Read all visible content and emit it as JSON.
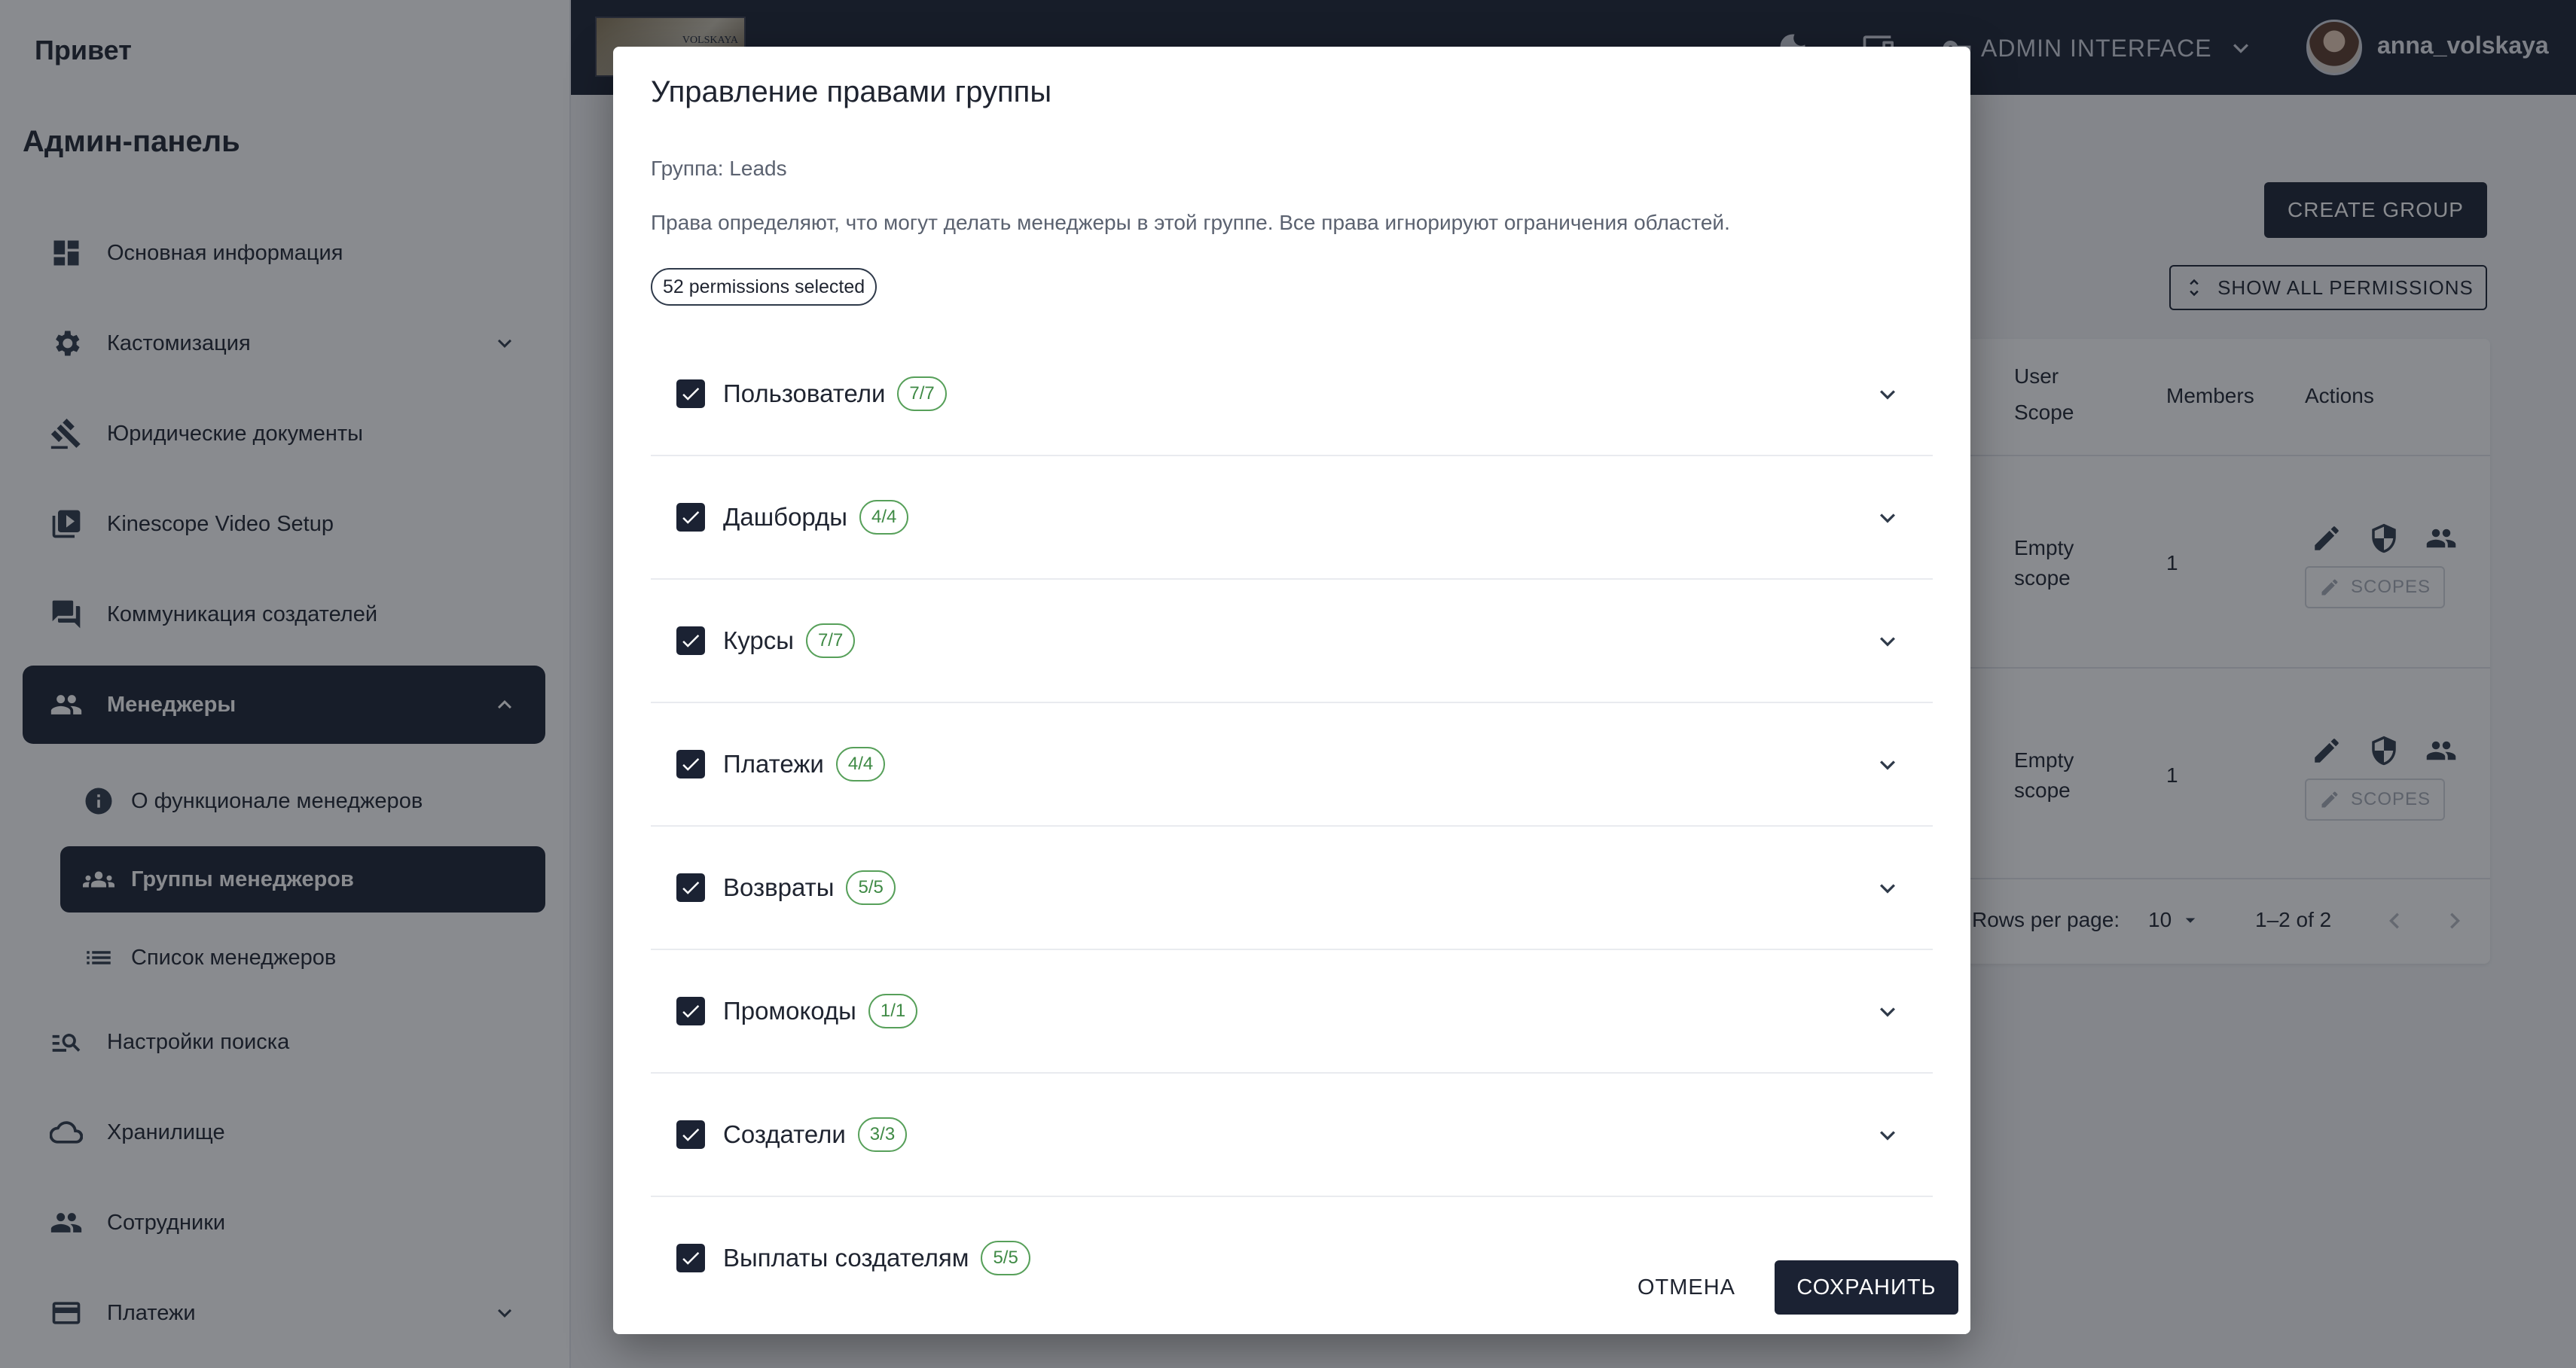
{
  "sidebar": {
    "greeting": "Привет",
    "panel_title": "Админ-панель",
    "items": [
      {
        "label": "Основная информация"
      },
      {
        "label": "Кастомизация"
      },
      {
        "label": "Юридические документы"
      },
      {
        "label": "Kinescope Video Setup"
      },
      {
        "label": "Коммуникация создателей"
      },
      {
        "label": "Менеджеры"
      },
      {
        "label": "Настройки поиска"
      },
      {
        "label": "Хранилище"
      },
      {
        "label": "Сотрудники"
      },
      {
        "label": "Платежи"
      }
    ],
    "sub_items": [
      {
        "label": "О функционале менеджеров"
      },
      {
        "label": "Группы менеджеров"
      },
      {
        "label": "Список менеджеров"
      }
    ]
  },
  "topbar": {
    "logo_text": "VOLSKAYA",
    "interface_label": "ADMIN INTERFACE",
    "username": "anna_volskaya"
  },
  "background": {
    "create_group_label": "CREATE GROUP",
    "show_all_label": "SHOW ALL PERMISSIONS",
    "columns": [
      "User",
      "Scope",
      "Members",
      "Actions"
    ],
    "rows": [
      {
        "scope_line1": "Empty",
        "scope_line2": "scope",
        "members": "1",
        "scopes_label": "SCOPES"
      },
      {
        "scope_line1": "Empty",
        "scope_line2": "scope",
        "members": "1",
        "scopes_label": "SCOPES"
      }
    ],
    "pagination": {
      "rows_per_page_label": "Rows per page:",
      "rows_per_page": "10",
      "range": "1–2 of 2"
    }
  },
  "modal": {
    "title": "Управление правами группы",
    "group_line": "Группа: Leads",
    "description": "Права определяют, что могут делать менеджеры в этой группе. Все права игнорируют ограничения областей.",
    "selected_chip": "52 permissions selected",
    "permissions": [
      {
        "label": "Пользователи",
        "count": "7/7"
      },
      {
        "label": "Дашборды",
        "count": "4/4"
      },
      {
        "label": "Курсы",
        "count": "7/7"
      },
      {
        "label": "Платежи",
        "count": "4/4"
      },
      {
        "label": "Возвраты",
        "count": "5/5"
      },
      {
        "label": "Промокоды",
        "count": "1/1"
      },
      {
        "label": "Создатели",
        "count": "3/3"
      },
      {
        "label": "Выплаты создателям",
        "count": "5/5"
      }
    ],
    "cancel_label": "ОТМЕНА",
    "save_label": "СОХРАНИТЬ"
  },
  "colors": {
    "primary": "#1b2233",
    "chip_green": "#57a05a",
    "overlay": "#14182080"
  }
}
